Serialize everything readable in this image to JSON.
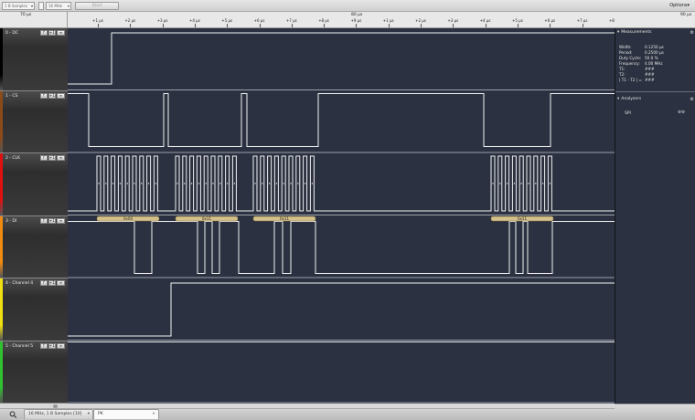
{
  "toolbar": {
    "samples_value": "1 B Samples",
    "rate_value": "16 MHz",
    "start_label": "Start",
    "options_label": "Options▾"
  },
  "ruler": {
    "left_abs": "70 µs",
    "center_abs": "80 µs",
    "right_abs": "90 µs",
    "ticks": [
      "+1 µs",
      "+2 µs",
      "+3 µs",
      "+4 µs",
      "+5 µs",
      "+6 µs",
      "+7 µs",
      "+8 µs",
      "+9 µs",
      "+1 µs",
      "+2 µs",
      "+3 µs",
      "+4 µs",
      "+5 µs",
      "+6 µs",
      "+7 µs",
      "+8 µs",
      "+9 µs"
    ]
  },
  "channels": [
    {
      "name": "0 - DC",
      "color": "#000000"
    },
    {
      "name": "1 - CS",
      "color": "#8a4a1a"
    },
    {
      "name": "2 - CLK",
      "color": "#e01010"
    },
    {
      "name": "3 - DI",
      "color": "#f08a10"
    },
    {
      "name": "4 - Channel 4",
      "color": "#f0e010"
    },
    {
      "name": "5 - Channel 5",
      "color": "#30c030"
    }
  ],
  "channel_buttons": {
    "f": "f",
    "plus": "+1",
    "menu": "≡"
  },
  "spi_bytes": [
    "0x00",
    "0x11",
    "0x11",
    "0x11"
  ],
  "measurements": {
    "header": "Measurements",
    "rows": [
      {
        "label": "Width:",
        "value": "0.1250 µs"
      },
      {
        "label": "Period:",
        "value": "0.2500 µs"
      },
      {
        "label": "Duty Cycle:",
        "value": "50.0 %"
      },
      {
        "label": "Frequency:",
        "value": "4.00 MHz"
      },
      {
        "label": "T1:",
        "value": "###"
      },
      {
        "label": "T2:",
        "value": "###"
      },
      {
        "label": "| T1 - T2 | =",
        "value": "###"
      }
    ]
  },
  "analyzers": {
    "header": "Analyzers",
    "items": [
      {
        "label": "SPI"
      }
    ]
  },
  "tabs": [
    {
      "label": "16 MHz, 1 B Samples [10]"
    },
    {
      "label": "PK"
    }
  ]
}
